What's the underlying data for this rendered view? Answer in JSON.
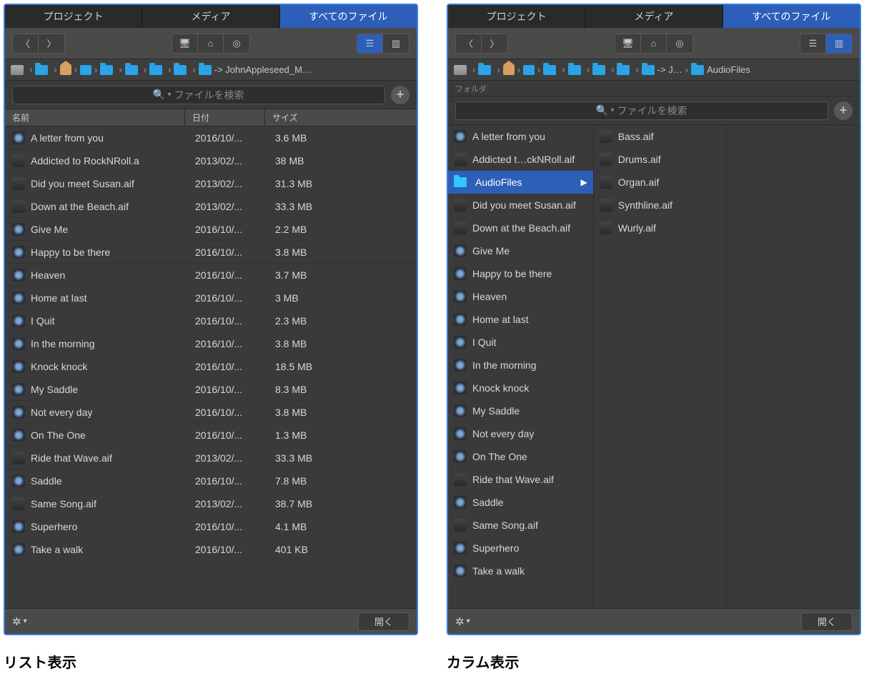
{
  "captions": {
    "list": "リスト表示",
    "column": "カラム表示"
  },
  "tabs": {
    "project": "プロジェクト",
    "media": "メディア",
    "all_files": "すべてのファイル"
  },
  "search": {
    "placeholder": "ファイルを検索"
  },
  "headers": {
    "name": "名前",
    "date": "日付",
    "size": "サイズ"
  },
  "footer": {
    "open": "開く"
  },
  "left": {
    "breadcrumb_tail": "-> JohnAppleseed_M…",
    "files": [
      {
        "name": "A letter from you",
        "date": "2016/10/...",
        "size": "3.6 MB",
        "type": "proj"
      },
      {
        "name": "Addicted to RockNRoll.a",
        "date": "2013/02/...",
        "size": "38 MB",
        "type": "audio"
      },
      {
        "name": "Did you meet Susan.aif",
        "date": "2013/02/...",
        "size": "31.3 MB",
        "type": "audio"
      },
      {
        "name": "Down at the Beach.aif",
        "date": "2013/02/...",
        "size": "33.3 MB",
        "type": "audio"
      },
      {
        "name": "Give Me",
        "date": "2016/10/...",
        "size": "2.2 MB",
        "type": "proj"
      },
      {
        "name": "Happy to be there",
        "date": "2016/10/...",
        "size": "3.8 MB",
        "type": "proj"
      },
      {
        "name": "Heaven",
        "date": "2016/10/...",
        "size": "3.7 MB",
        "type": "proj"
      },
      {
        "name": "Home at last",
        "date": "2016/10/...",
        "size": "3 MB",
        "type": "proj"
      },
      {
        "name": "I Quit",
        "date": "2016/10/...",
        "size": "2.3 MB",
        "type": "proj"
      },
      {
        "name": "In the morning",
        "date": "2016/10/...",
        "size": "3.8 MB",
        "type": "proj"
      },
      {
        "name": "Knock knock",
        "date": "2016/10/...",
        "size": "18.5 MB",
        "type": "proj"
      },
      {
        "name": "My Saddle",
        "date": "2016/10/...",
        "size": "8.3 MB",
        "type": "proj"
      },
      {
        "name": "Not every day",
        "date": "2016/10/...",
        "size": "3.8 MB",
        "type": "proj"
      },
      {
        "name": "On The One",
        "date": "2016/10/...",
        "size": "1.3 MB",
        "type": "proj"
      },
      {
        "name": "Ride that Wave.aif",
        "date": "2013/02/...",
        "size": "33.3 MB",
        "type": "audio"
      },
      {
        "name": "Saddle",
        "date": "2016/10/...",
        "size": "7.8 MB",
        "type": "proj"
      },
      {
        "name": "Same Song.aif",
        "date": "2013/02/...",
        "size": "38.7 MB",
        "type": "audio"
      },
      {
        "name": "Superhero",
        "date": "2016/10/...",
        "size": "4.1 MB",
        "type": "proj"
      },
      {
        "name": "Take a walk",
        "date": "2016/10/...",
        "size": "401 KB",
        "type": "proj"
      }
    ]
  },
  "right": {
    "breadcrumb_tail": "-> J…",
    "breadcrumb_end": "AudioFiles",
    "subheader": "フォルダ",
    "col1": [
      {
        "name": "A letter from you",
        "type": "proj"
      },
      {
        "name": "Addicted t…ckNRoll.aif",
        "type": "audio"
      },
      {
        "name": "AudioFiles",
        "type": "folder",
        "selected": true,
        "hasSub": true
      },
      {
        "name": "Did you meet Susan.aif",
        "type": "audio"
      },
      {
        "name": "Down at the Beach.aif",
        "type": "audio"
      },
      {
        "name": "Give Me",
        "type": "proj"
      },
      {
        "name": "Happy to be there",
        "type": "proj"
      },
      {
        "name": "Heaven",
        "type": "proj"
      },
      {
        "name": "Home at last",
        "type": "proj"
      },
      {
        "name": "I Quit",
        "type": "proj"
      },
      {
        "name": "In the morning",
        "type": "proj"
      },
      {
        "name": "Knock knock",
        "type": "proj"
      },
      {
        "name": "My Saddle",
        "type": "proj"
      },
      {
        "name": "Not every day",
        "type": "proj"
      },
      {
        "name": "On The One",
        "type": "proj"
      },
      {
        "name": "Ride that Wave.aif",
        "type": "audio"
      },
      {
        "name": "Saddle",
        "type": "proj"
      },
      {
        "name": "Same Song.aif",
        "type": "audio"
      },
      {
        "name": "Superhero",
        "type": "proj"
      },
      {
        "name": "Take a walk",
        "type": "proj"
      }
    ],
    "col2": [
      {
        "name": "Bass.aif",
        "type": "audio"
      },
      {
        "name": "Drums.aif",
        "type": "audio"
      },
      {
        "name": "Organ.aif",
        "type": "audio"
      },
      {
        "name": "Synthline.aif",
        "type": "audio"
      },
      {
        "name": "Wurly.aif",
        "type": "audio"
      }
    ]
  }
}
